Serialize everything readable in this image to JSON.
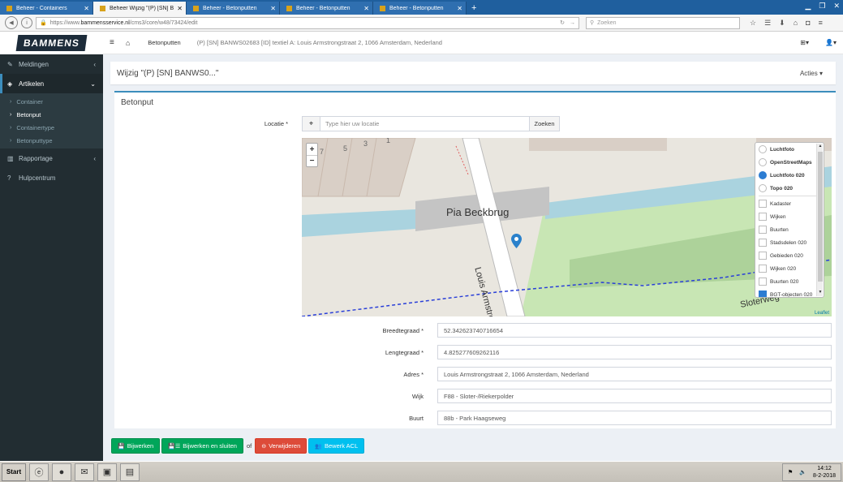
{
  "browser": {
    "tabs": [
      {
        "label": "Beheer - Containers",
        "active": false
      },
      {
        "label": "Beheer Wijzig \"(P) [SN] BANW...",
        "active": true
      },
      {
        "label": "Beheer - Betonputten",
        "active": false
      },
      {
        "label": "Beheer - Betonputten",
        "active": false
      },
      {
        "label": "Beheer - Betonputten",
        "active": false
      }
    ],
    "url_prefix": "https://www.",
    "url_domain": "bammensservice.nl",
    "url_path": "/cms3/core/w48/73424/edit",
    "search_placeholder": "Zoeken"
  },
  "sidebar": {
    "logo_text": "BAMMENS",
    "items": [
      {
        "label": "Meldingen"
      },
      {
        "label": "Artikelen"
      },
      {
        "label": "Rapportage"
      },
      {
        "label": "Hulpcentrum"
      }
    ],
    "sub_items": [
      {
        "label": "Container"
      },
      {
        "label": "Betonput"
      },
      {
        "label": "Containertype"
      },
      {
        "label": "Betonputtype"
      }
    ]
  },
  "header": {
    "crumb_section": "Betonputten",
    "crumb_current": "(P) [SN] BANWS02683 [ID] textiel A: Louis Armstrongstraat 2, 1066 Amsterdam, Nederland"
  },
  "page": {
    "title": "Wijzig \"(P) [SN] BANWS0...\"",
    "actions_label": "Acties",
    "box_title": "Betonput"
  },
  "form": {
    "locatie_label": "Locatie *",
    "locatie_placeholder": "Type hier uw locatie",
    "zoeken_label": "Zoeken",
    "fields": [
      {
        "label": "Breedtegraad *",
        "value": "52.342623740716654"
      },
      {
        "label": "Lengtegraad *",
        "value": "4.825277609262116"
      },
      {
        "label": "Adres *",
        "value": "Louis Armstrongstraat 2, 1066 Amsterdam, Nederland"
      },
      {
        "label": "Wijk",
        "value": "F88 - Sloter-/Riekerpolder"
      },
      {
        "label": "Buurt",
        "value": "88b - Park Haagseweg"
      }
    ]
  },
  "map": {
    "zoom_in": "+",
    "zoom_out": "−",
    "label_bridge": "Pia Beckbrug",
    "label_street": "Louis Armstro",
    "label_street2": "Sloterweg",
    "house_numbers": [
      "7",
      "5",
      "3",
      "1"
    ],
    "attribution": "Leaflet",
    "base_layers": [
      {
        "label": "Luchtfoto",
        "selected": false
      },
      {
        "label": "OpenStreetMaps",
        "selected": false
      },
      {
        "label": "Luchtfoto 020",
        "selected": true
      },
      {
        "label": "Topo 020",
        "selected": false
      }
    ],
    "overlays": [
      {
        "label": "Kadaster",
        "checked": false
      },
      {
        "label": "Wijken",
        "checked": false
      },
      {
        "label": "Buurten",
        "checked": false
      },
      {
        "label": "Stadsdelen 020",
        "checked": false
      },
      {
        "label": "Gebieden 020",
        "checked": false
      },
      {
        "label": "Wijken 020",
        "checked": false
      },
      {
        "label": "Buurten 020",
        "checked": false
      },
      {
        "label": "BGT-objecten 020",
        "checked": true
      }
    ]
  },
  "buttons": {
    "bijwerken": "Bijwerken",
    "bijwerken_sluiten": "Bijwerken en sluiten",
    "of": "of",
    "verwijderen": "Verwijderen",
    "bewerk_acl": "Bewerk ACL"
  },
  "taskbar": {
    "start": "Start",
    "time": "14:12",
    "date": "8-2-2018"
  },
  "colors": {
    "primary": "#3c8dbc",
    "success": "#00a65a",
    "danger": "#dd4b39",
    "info": "#00c0ef",
    "sidebar": "#222d32"
  }
}
